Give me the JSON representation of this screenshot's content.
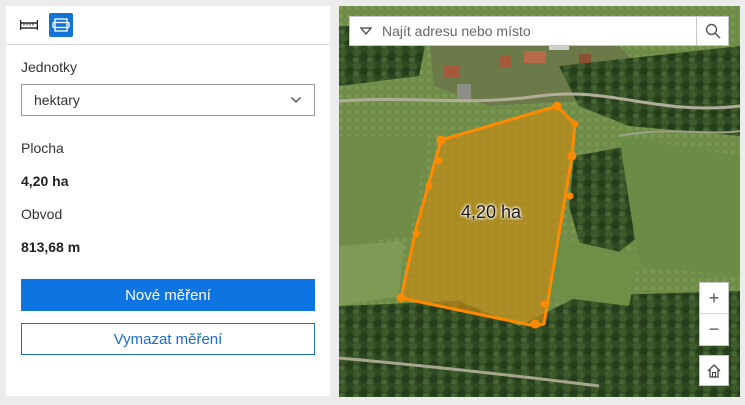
{
  "panel": {
    "tools": [
      {
        "icon": "distance-ruler-icon",
        "active": false
      },
      {
        "icon": "area-measure-icon",
        "active": true
      }
    ],
    "units_label": "Jednotky",
    "units_value": "hektary",
    "area_label": "Plocha",
    "area_value": "4,20 ha",
    "perimeter_label": "Obvod",
    "perimeter_value": "813,68 m",
    "new_measure_button": "Nové měření",
    "clear_measure_button": "Vymazat měření"
  },
  "map": {
    "search_placeholder": "Najít adresu nebo místo",
    "polygon_label": "4,20 ha",
    "zoom_in": "+",
    "zoom_out": "−",
    "polygon_color": "#ff8a00"
  }
}
